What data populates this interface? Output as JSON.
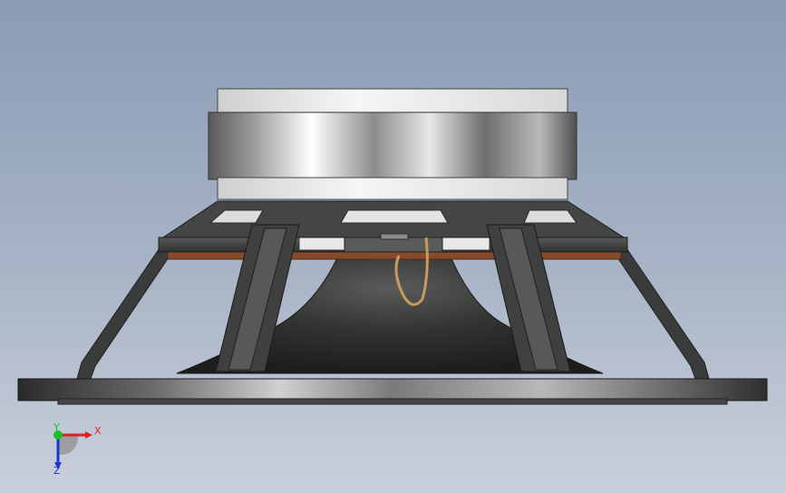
{
  "viewport": {
    "background_top": "#8a9bb5",
    "background_bottom": "#c9d0db"
  },
  "model": {
    "description_label": "",
    "magnet_color": "#c9c9c9",
    "frame_color": "#3d3f3e",
    "cone_color": "#2b2d2b",
    "gasket_color": "#8a4a2a",
    "lead_wire_color": "#c99a5a"
  },
  "triad": {
    "x_label": "X",
    "y_label": "Y",
    "z_label": "Z",
    "x_color": "#e02020",
    "y_color": "#18c020",
    "z_color": "#2030d8"
  }
}
